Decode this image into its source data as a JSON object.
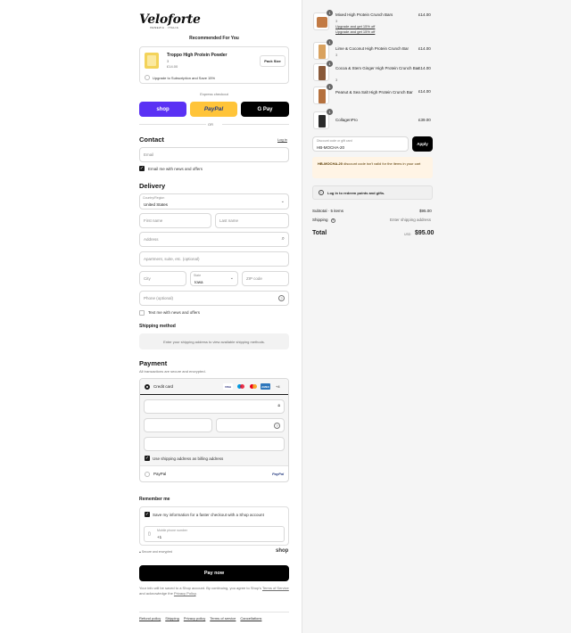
{
  "brand": {
    "name": "Veloforte",
    "sub": "VENEZIA · ITALIA"
  },
  "recommend": {
    "title": "Recommended For You",
    "product_name": "Troppo High Protein Powder",
    "product_qty": "3",
    "product_price": "£14.00",
    "pack_button": "Pack Size",
    "subscribe_text": "Upgrade to Subscription and Save 15%"
  },
  "express": {
    "label": "Express checkout",
    "shop": "shop",
    "paypal": "PayPal",
    "gpay": "G Pay",
    "or": "OR"
  },
  "contact": {
    "title": "Contact",
    "login": "Log in",
    "email_placeholder": "Email",
    "news_label": "Email me with news and offers"
  },
  "delivery": {
    "title": "Delivery",
    "country_label": "Country/Region",
    "country_value": "United States",
    "first_name": "First name",
    "last_name": "Last name",
    "address": "Address",
    "apartment": "Apartment, suite, etc. (optional)",
    "city": "City",
    "state_label": "State",
    "state_value": "Iowa",
    "zip": "ZIP code",
    "phone": "Phone (optional)",
    "text_news": "Text me with news and offers"
  },
  "shipping": {
    "title": "Shipping method",
    "notice": "Enter your shipping address to view available shipping methods."
  },
  "payment": {
    "title": "Payment",
    "subtitle": "All transactions are secure and encrypted.",
    "credit_card": "Credit card",
    "more_cards": "+4",
    "use_shipping": "Use shipping address as billing address",
    "paypal": "PayPal",
    "paypal_logo": "PayPal"
  },
  "remember": {
    "title": "Remember me",
    "save_info": "Save my information for a faster checkout with a Shop account",
    "mobile_label": "Mobile phone number",
    "mobile_value": "+1",
    "secure": "Secure and encrypted",
    "shop_logo": "shop"
  },
  "pay_now": "Pay now",
  "legal": {
    "text1": "Your info will be saved to a Shop account. By continuing, you agree to Shop's",
    "terms": "Terms of Service",
    "and_ack": "and acknowledge the",
    "privacy": "Privacy Policy",
    "period": "."
  },
  "footer_links": [
    "Refund policy",
    "Shipping",
    "Privacy policy",
    "Terms of service",
    "Cancellations"
  ],
  "cart": {
    "items": [
      {
        "name": "Mixed High Protein Crunch Bars",
        "qty_badge": "1",
        "sub": "3",
        "price": "£14.00",
        "upgrade": [
          "Upgrade and get 15% off",
          "Upgrade and get 15% off"
        ]
      },
      {
        "name": "Lime & Coconut High Protein Crunch Bar",
        "qty_badge": "1",
        "sub": "3",
        "price": "£14.00"
      },
      {
        "name": "Cocoa & Stem Ginger High Protein Crunch Bar",
        "qty_badge": "1",
        "sub": "3",
        "price": "£14.00"
      },
      {
        "name": "Peanut & Sea Salt High Protein Crunch Bar",
        "qty_badge": "1",
        "sub": "",
        "price": "£14.00"
      },
      {
        "name": "CollagenPro",
        "qty_badge": "1",
        "sub": "",
        "price": "£39.00"
      }
    ],
    "discount_label": "Discount code or gift card",
    "discount_value": "HB-MOCHA-20",
    "apply": "Apply",
    "error_code": "HB-MOCHA-20",
    "error_text": "discount code isn't valid for the items in your cart",
    "login_points": "Log in to redeem points and gifts.",
    "subtotal_label": "Subtotal · 5 items",
    "subtotal_value": "$95.00",
    "shipping_label": "Shipping",
    "shipping_value": "Enter shipping address",
    "total_label": "Total",
    "currency": "USD",
    "total_value": "$95.00"
  },
  "colors": {
    "shop": "#5a31f4",
    "paypal": "#ffc439",
    "dark": "#000000",
    "error_bg": "#fff4e5"
  }
}
